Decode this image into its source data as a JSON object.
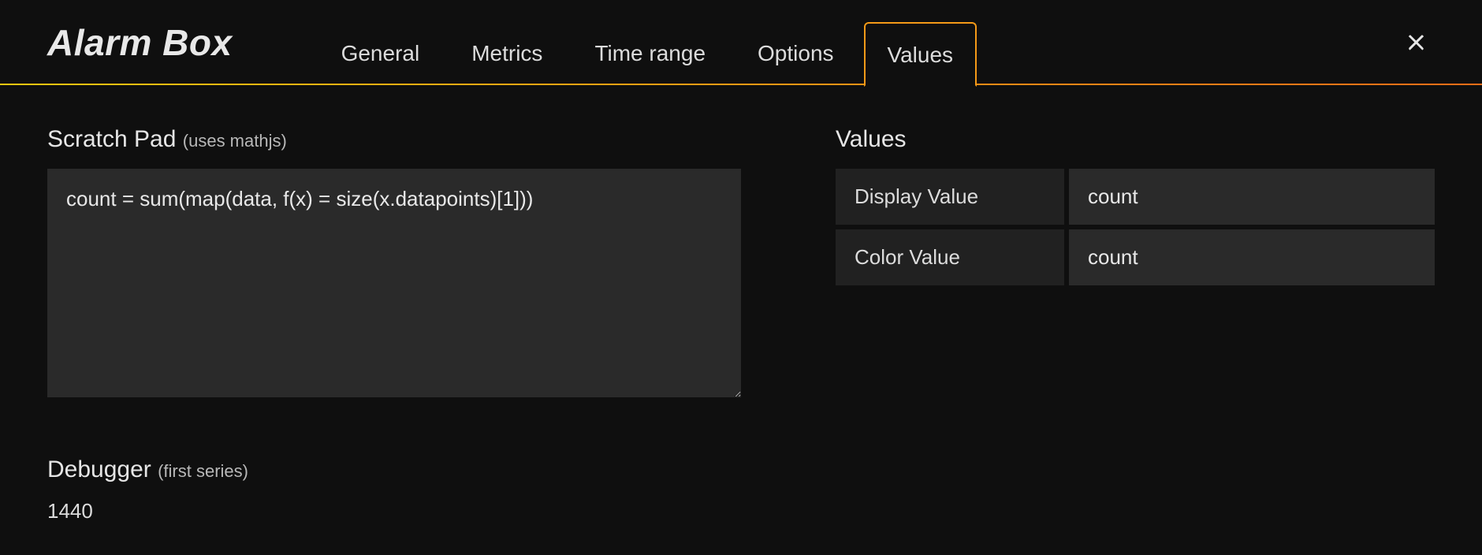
{
  "header": {
    "title": "Alarm Box",
    "tabs": [
      {
        "label": "General",
        "active": false
      },
      {
        "label": "Metrics",
        "active": false
      },
      {
        "label": "Time range",
        "active": false
      },
      {
        "label": "Options",
        "active": false
      },
      {
        "label": "Values",
        "active": true
      }
    ]
  },
  "scratchpad": {
    "title": "Scratch Pad",
    "subtitle": "(uses mathjs)",
    "value": "count = sum(map(data, f(x) = size(x.datapoints)[1]))"
  },
  "values_section": {
    "title": "Values",
    "rows": [
      {
        "label": "Display Value",
        "value": "count"
      },
      {
        "label": "Color Value",
        "value": "count"
      }
    ]
  },
  "debugger": {
    "title": "Debugger",
    "subtitle": "(first series)",
    "output": "1440"
  }
}
